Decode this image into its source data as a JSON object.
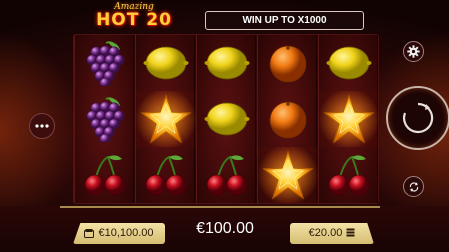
{
  "header": {
    "logo_script": "Amazing",
    "logo_main": "HOT 20",
    "win_banner": "WIN UP TO X1000"
  },
  "reels": [
    [
      "grapes",
      "grapes",
      "cherries"
    ],
    [
      "lemon",
      "star",
      "cherries"
    ],
    [
      "lemon",
      "lemon",
      "cherries"
    ],
    [
      "orange",
      "orange",
      "star"
    ],
    [
      "lemon",
      "star",
      "cherries"
    ]
  ],
  "footer": {
    "balance": "€10,100.00",
    "win": "€100.00",
    "bet": "€20.00"
  },
  "icons": {
    "menu": "more-dots-icon",
    "settings": "gear-icon",
    "spin": "spin-arrow-icon",
    "autoplay": "autoplay-icon",
    "balance": "wallet-icon",
    "bet": "coins-icon"
  },
  "colors": {
    "accent_gold": "#d6bd72",
    "background_red": "#3a0909"
  }
}
